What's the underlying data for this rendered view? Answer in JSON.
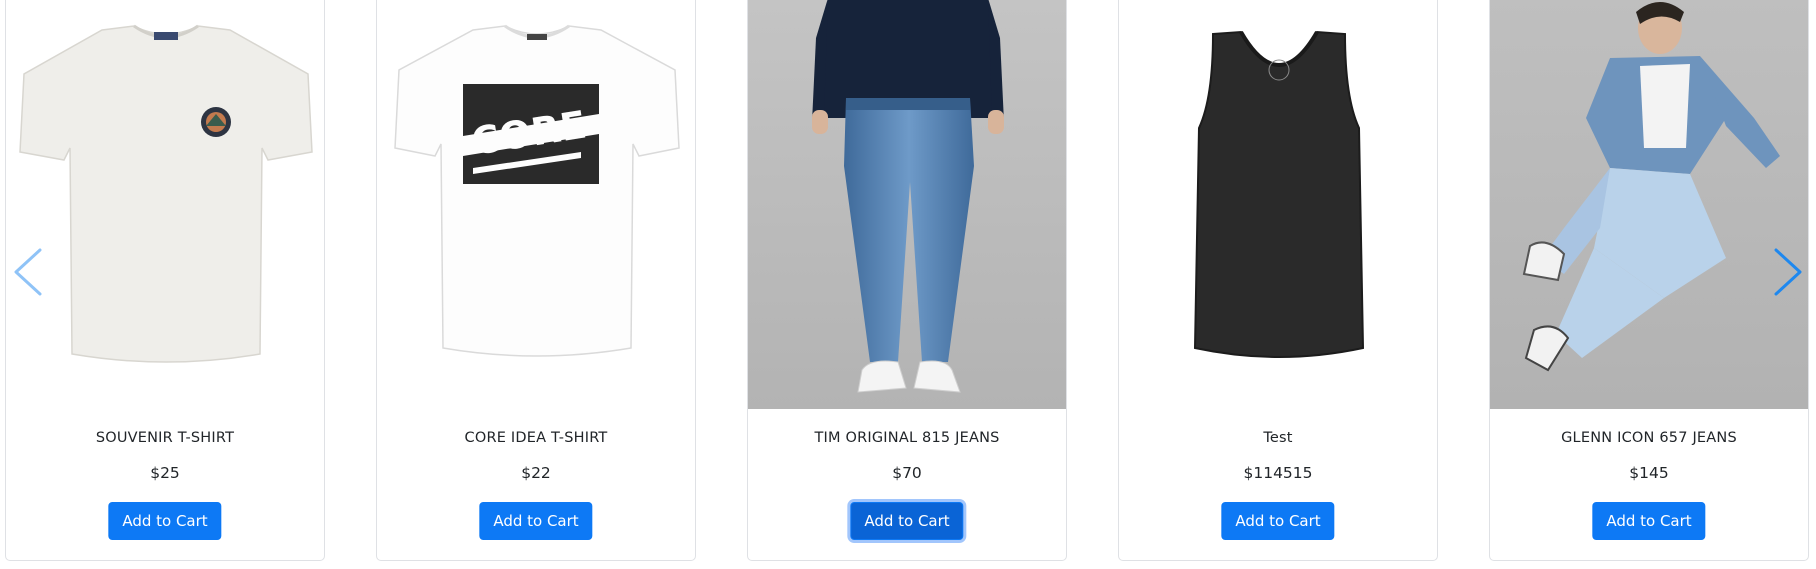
{
  "carousel": {
    "prev_icon": "chevron-left-icon",
    "next_icon": "chevron-right-icon",
    "arrow_color_prev": "#8fc3f7",
    "arrow_color_next": "#1e88ef",
    "products": [
      {
        "name": "SOUVENIR T-SHIRT",
        "price": "$25",
        "button": "Add to Cart",
        "image": "white-tshirt-with-chest-badge"
      },
      {
        "name": "CORE IDEA T-SHIRT",
        "price": "$22",
        "button": "Add to Cart",
        "image": "white-tshirt-with-core-print"
      },
      {
        "name": "TIM ORIGINAL 815 JEANS",
        "price": "$70",
        "button": "Add to Cart",
        "image": "model-wearing-blue-jeans"
      },
      {
        "name": "Test",
        "price": "$114515",
        "button": "Add to Cart",
        "image": "black-tank-top"
      },
      {
        "name": "GLENN ICON 657 JEANS",
        "price": "$145",
        "button": "Add to Cart",
        "image": "model-sitting-in-denim"
      }
    ]
  },
  "colors": {
    "button": "#0d79f5",
    "border": "#dfe1e5",
    "text": "#212529"
  }
}
